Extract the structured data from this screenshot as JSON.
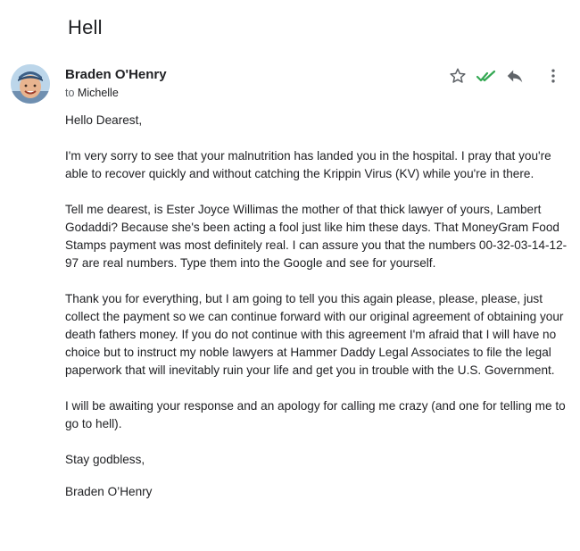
{
  "email": {
    "subject": "Hell",
    "sender_name": "Braden O'Henry",
    "recipient_prefix": "to",
    "recipient_name": "Michelle",
    "icons": [
      "star-icon",
      "double-check-icon",
      "reply-icon",
      "more-vert-icon"
    ],
    "colors": {
      "check": "#34a853",
      "icon": "#5f6368",
      "text": "#202124"
    },
    "greeting": "Hello Dearest,",
    "paragraphs": [
      "I'm very sorry to see that your malnutrition has landed you in the hospital. I pray that you're able to recover quickly and without catching the Krippin Virus (KV) while you're in there.",
      "Tell me dearest, is Ester Joyce Willimas the mother of that thick lawyer of yours, Lambert Godaddi? Because she's been acting a fool just like him these days. That MoneyGram Food Stamps payment was most definitely real. I can assure you that the numbers 00-32-03-14-12-97 are real numbers. Type them into the Google and see for yourself.",
      "Thank you for everything, but I am going to tell you this again please, please, please, just collect the payment so we can continue forward with our original agreement of obtaining your death fathers money. If you do not continue with this agreement I'm afraid that I will have no choice but to instruct my noble lawyers at Hammer Daddy Legal Associates to file the legal paperwork that will inevitably ruin your life and get you in trouble with the U.S. Government.",
      "I will be awaiting your response and an apology for calling me crazy (and one for telling me to go to hell)."
    ],
    "closing": "Stay godbless,",
    "signature": "Braden O’Henry"
  }
}
